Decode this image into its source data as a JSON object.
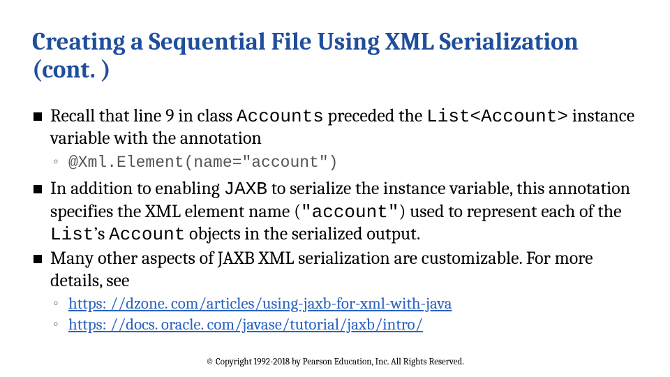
{
  "title": "Creating a Sequential File Using XML Serialization (cont. )",
  "bullets": {
    "b1_a": "Recall that line 9 in class ",
    "b1_code1": "Accounts",
    "b1_b": " preceded the ",
    "b1_code2": "List<Account>",
    "b1_c": " instance variable with the annotation",
    "s1_code": "@Xml.Element(name=\"account\")",
    "b2_a": "In addition to enabling ",
    "b2_code1": "JAXB",
    "b2_b": " to serialize the instance variable, this annotation specifies the XML element name (",
    "b2_code2": "\"account\"",
    "b2_c": ") used to represent each of the ",
    "b2_code3": "List",
    "b2_d": "’s ",
    "b2_code4": "Account",
    "b2_e": " objects in the serialized output.",
    "b3": "Many other aspects of JAXB XML serialization are customizable. For more details, see",
    "link1": "https: //dzone. com/articles/using-jaxb-for-xml-with-java",
    "link2": "https: //docs. oracle. com/javase/tutorial/jaxb/intro/"
  },
  "copyright": "© Copyright 1992-2018 by Pearson Education, Inc. All Rights Reserved."
}
